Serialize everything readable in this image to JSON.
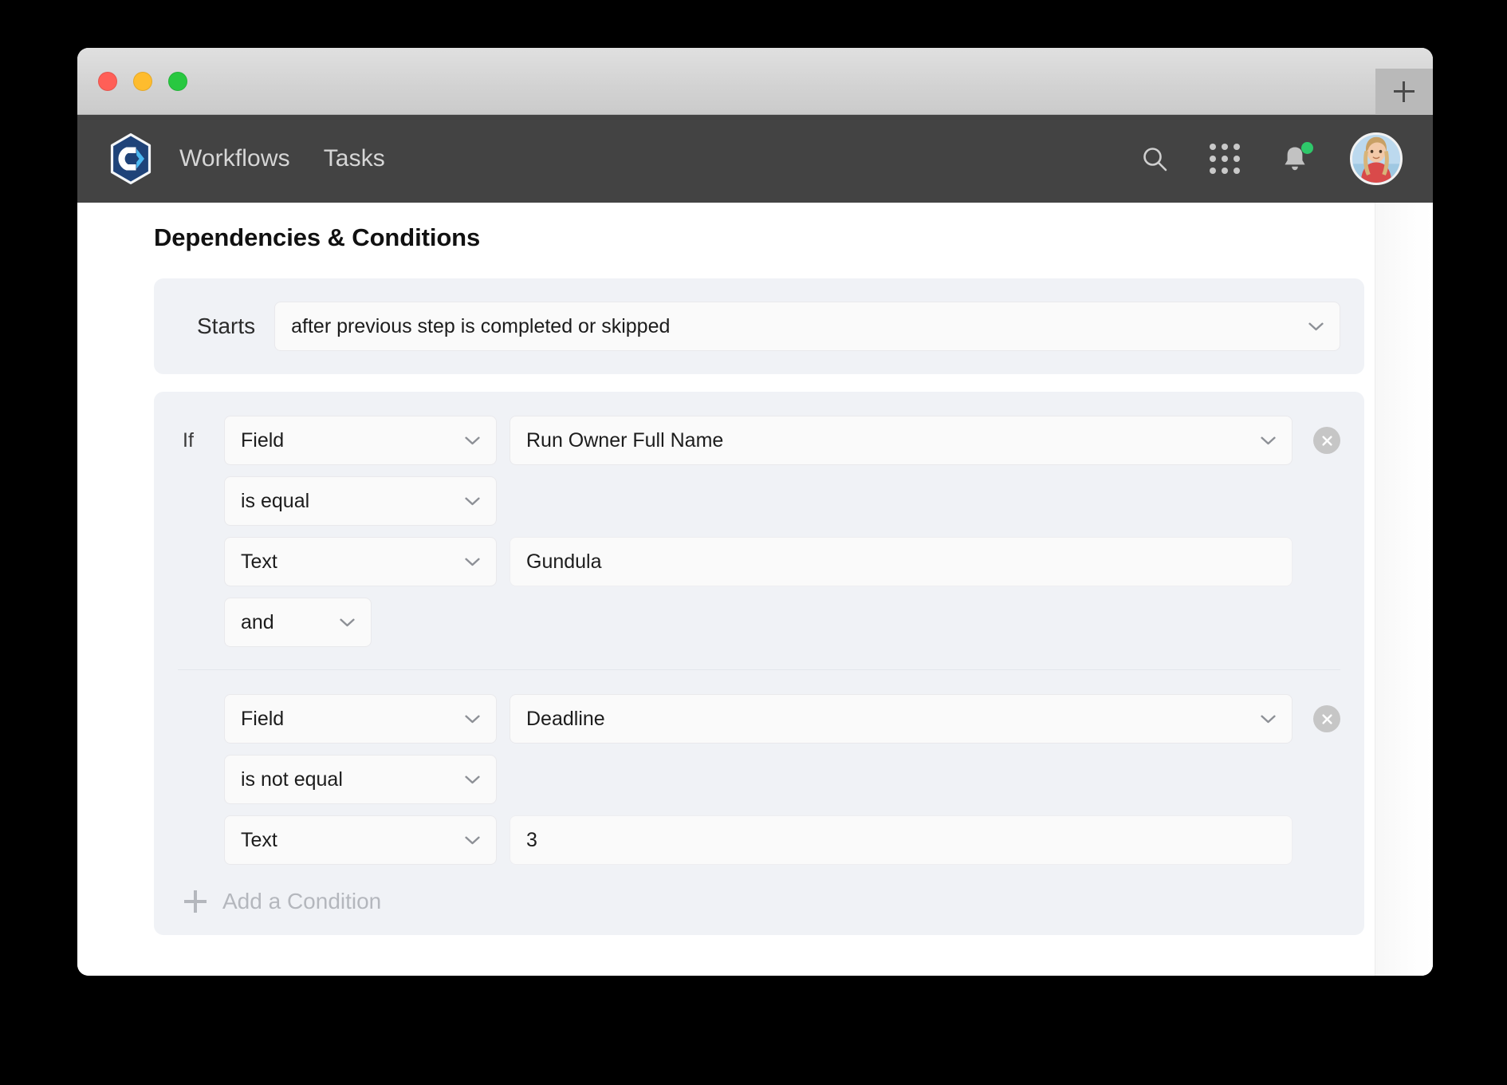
{
  "browser": {
    "new_tab_label": "+",
    "window_controls": [
      "close",
      "minimize",
      "maximize"
    ]
  },
  "appbar": {
    "logo_name": "app-logo",
    "nav": [
      {
        "label": "Workflows"
      },
      {
        "label": "Tasks"
      }
    ],
    "actions": [
      {
        "name": "search-icon",
        "label": "Search"
      },
      {
        "name": "apps-grid-icon",
        "label": "Apps"
      },
      {
        "name": "notifications-bell-icon",
        "label": "Notifications",
        "badge": true
      }
    ],
    "avatar_label": "User profile"
  },
  "main": {
    "title": "Dependencies & Conditions",
    "starts": {
      "label": "Starts",
      "value": "after previous step is completed or skipped"
    },
    "conditions": {
      "if_label": "If",
      "groups": [
        {
          "source_type": "Field",
          "source_value": "Run Owner Full Name",
          "operator": "is equal",
          "value_type": "Text",
          "value": "Gundula",
          "logic": "and",
          "has_logic": true,
          "remove_label": "Remove condition"
        },
        {
          "source_type": "Field",
          "source_value": "Deadline",
          "operator": "is not equal",
          "value_type": "Text",
          "value": "3",
          "logic": "",
          "has_logic": false,
          "remove_label": "Remove condition"
        }
      ],
      "add_label": "Add a Condition"
    }
  },
  "colors": {
    "appbar_bg": "#434343",
    "panel_bg": "#f0f2f6",
    "field_bg": "#fafafa",
    "accent_notification": "#2ec86a",
    "muted_text": "#b4b7bd",
    "logo_navy": "#1f4379",
    "logo_blue": "#4cb8f0"
  }
}
